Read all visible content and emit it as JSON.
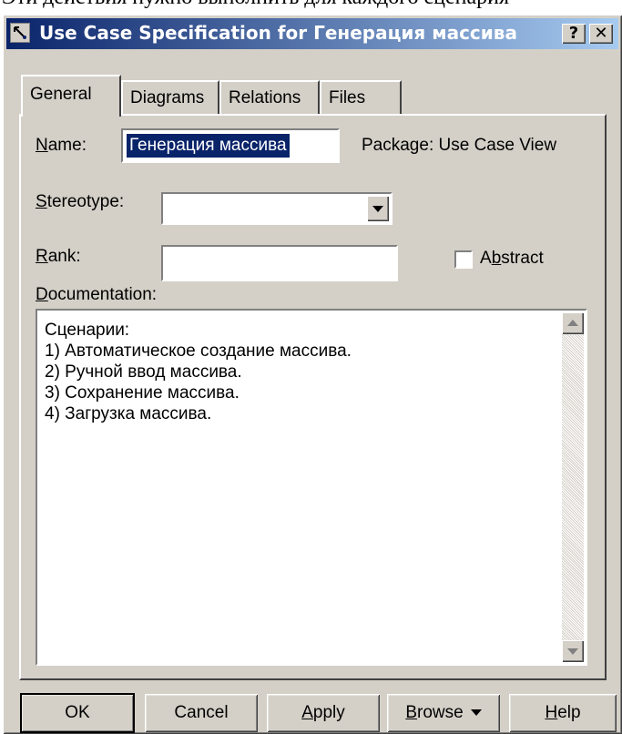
{
  "background_text": "Эти действия нужно выполнить для каждого сценария",
  "window": {
    "title": "Use Case Specification for Генерация массива",
    "help_button": "?",
    "close_button": "✕"
  },
  "tabs": [
    {
      "label": "General",
      "active": true
    },
    {
      "label": "Diagrams",
      "active": false
    },
    {
      "label": "Relations",
      "active": false
    },
    {
      "label": "Files",
      "active": false
    }
  ],
  "general": {
    "name_label_u": "N",
    "name_label_rest": "ame:",
    "name_value": "Генерация массива",
    "package_label": "Package:",
    "package_value": "Use Case View",
    "stereotype_label_u": "S",
    "stereotype_label_rest": "tereotype:",
    "stereotype_value": "",
    "rank_label_u": "R",
    "rank_label_rest": "ank:",
    "rank_value": "",
    "abstract_label_a": "A",
    "abstract_label_u": "b",
    "abstract_label_rest": "stract",
    "abstract_checked": false,
    "documentation_label_u": "D",
    "documentation_label_rest": "ocumentation:",
    "documentation_lines": [
      "Сценарии:",
      "1) Автоматическое создание массива.",
      "2) Ручной ввод массива.",
      "3) Сохранение массива.",
      "4) Загрузка массива."
    ]
  },
  "buttons": {
    "ok": "OK",
    "cancel": "Cancel",
    "apply_u": "A",
    "apply_rest": "pply",
    "browse_u": "B",
    "browse_rest": "rowse",
    "help_u": "H",
    "help_rest": "elp"
  }
}
